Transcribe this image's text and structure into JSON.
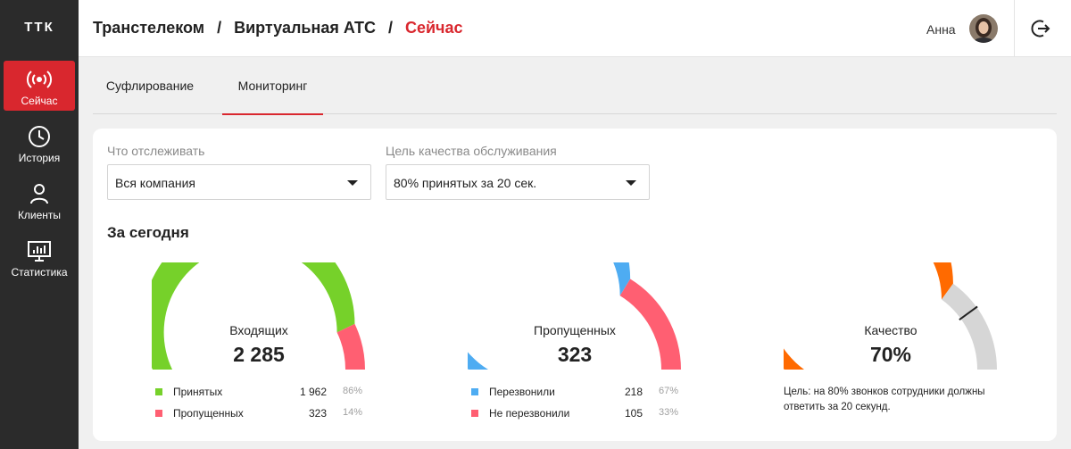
{
  "app": {
    "logo": "ТТК"
  },
  "sidebar": {
    "items": [
      {
        "label": "Сейчас",
        "icon": "broadcast-icon",
        "active": true
      },
      {
        "label": "История",
        "icon": "clock-icon",
        "active": false
      },
      {
        "label": "Клиенты",
        "icon": "user-icon",
        "active": false
      },
      {
        "label": "Статистика",
        "icon": "monitor-chart-icon",
        "active": false
      }
    ]
  },
  "header": {
    "breadcrumb": [
      "Транстелеком",
      "Виртуальная АТС",
      "Сейчас"
    ],
    "separator": "/",
    "user_name": "Анна",
    "logout_icon": "logout-icon"
  },
  "tabs": [
    {
      "label": "Суфлирование",
      "active": false
    },
    {
      "label": "Мониторинг",
      "active": true
    }
  ],
  "filters": {
    "track": {
      "label": "Что отслеживать",
      "value": "Вся компания"
    },
    "sla": {
      "label": "Цель качества обслуживания",
      "value": "80% принятых за 20 сек."
    }
  },
  "section_title": "За сегодня",
  "colors": {
    "accent": "#d9272e",
    "green": "#76d12a",
    "pink": "#ff5f72",
    "blue": "#4eacf2",
    "orange": "#ff6a00",
    "grey": "#d6d6d6"
  },
  "chart_data": [
    {
      "type": "pie",
      "label": "Входящих",
      "total": "2 285",
      "series": [
        {
          "name": "Принятых",
          "count": "1 962",
          "value": 1962,
          "percent": "86%"
        },
        {
          "name": "Пропущенных",
          "count": "323",
          "value": 323,
          "percent": "14%"
        }
      ]
    },
    {
      "type": "pie",
      "label": "Пропущенных",
      "total": "323",
      "series": [
        {
          "name": "Перезвонили",
          "count": "218",
          "value": 218,
          "percent": "67%"
        },
        {
          "name": "Не перезвонили",
          "count": "105",
          "value": 105,
          "percent": "33%"
        }
      ]
    },
    {
      "type": "pie",
      "label": "Качество",
      "total": "70%",
      "value": 70,
      "target": 80,
      "note": "Цель: на 80% звонков сотрудники должны ответить за 20 секунд."
    }
  ]
}
